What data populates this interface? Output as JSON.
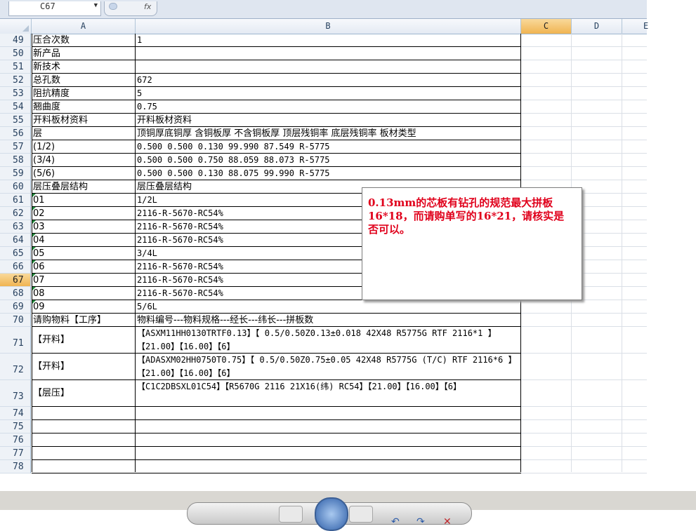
{
  "formula_bar": {
    "name_box": "C67",
    "fx_label": "fx"
  },
  "columns": [
    "A",
    "B",
    "C",
    "D",
    "E"
  ],
  "selected_column": "C",
  "selected_row": "67",
  "rows": [
    {
      "num": "49",
      "a": "压合次数",
      "b": "1"
    },
    {
      "num": "50",
      "a": "新产品",
      "b": ""
    },
    {
      "num": "51",
      "a": "新技术",
      "b": ""
    },
    {
      "num": "52",
      "a": "总孔数",
      "b": "672"
    },
    {
      "num": "53",
      "a": "阻抗精度",
      "b": "5"
    },
    {
      "num": "54",
      "a": "翘曲度",
      "b": "0.75"
    },
    {
      "num": "55",
      "a": "开料板材资料",
      "b": "开料板材资料"
    },
    {
      "num": "56",
      "a": "层",
      "b": "顶铜厚底铜厚 含铜板厚 不含铜板厚 顶层残铜率 底层残铜率 板材类型"
    },
    {
      "num": "57",
      "a": "(1/2)",
      "b": "0.500  0.500           0.130       99.990    87.549      R-5775"
    },
    {
      "num": "58",
      "a": "(3/4)",
      "b": "0.500  0.500           0.750       88.059    88.073      R-5775"
    },
    {
      "num": "59",
      "a": "(5/6)",
      "b": "0.500  0.500           0.130       88.075    99.990      R-5775"
    },
    {
      "num": "60",
      "a": "层压叠层结构",
      "b": "层压叠层结构"
    },
    {
      "num": "61",
      "a": "01",
      "b": "1/2L"
    },
    {
      "num": "62",
      "a": "02",
      "b": "2116-R-5670-RC54%"
    },
    {
      "num": "63",
      "a": "03",
      "b": "2116-R-5670-RC54%"
    },
    {
      "num": "64",
      "a": "04",
      "b": "2116-R-5670-RC54%"
    },
    {
      "num": "65",
      "a": "05",
      "b": "3/4L"
    },
    {
      "num": "66",
      "a": "06",
      "b": "2116-R-5670-RC54%"
    },
    {
      "num": "67",
      "a": "07",
      "b": "2116-R-5670-RC54%"
    },
    {
      "num": "68",
      "a": "08",
      "b": "2116-R-5670-RC54%"
    },
    {
      "num": "69",
      "a": "09",
      "b": "5/6L"
    },
    {
      "num": "70",
      "a": "请购物料【工序】",
      "b": "物料编号---物料规格---经长---纬长---拼板数"
    },
    {
      "num": "71",
      "a": "【开料】",
      "b": "【ASXM11HH0130TRTF0.13】【 0.5/0.50Z0.13±0.018 42X48  R5775G RTF 2116*1 】【21.00】【16.00】【6】"
    },
    {
      "num": "72",
      "a": "【开料】",
      "b": "【ADASXM02HH0750T0.75】【 0.5/0.50Z0.75±0.05 42X48  R5775G (T/C) RTF 2116*6 】【21.00】【16.00】【6】"
    },
    {
      "num": "73",
      "a": "【层压】",
      "b": "【C1C2DBSXL01C54】【R5670G 2116 21X16(纬) RC54】【21.00】【16.00】【6】"
    },
    {
      "num": "74",
      "a": "",
      "b": ""
    },
    {
      "num": "75",
      "a": "",
      "b": ""
    },
    {
      "num": "76",
      "a": "",
      "b": ""
    },
    {
      "num": "77",
      "a": "",
      "b": ""
    },
    {
      "num": "78",
      "a": "",
      "b": ""
    }
  ],
  "comment": {
    "text": "0.13mm的芯板有钻孔的规范最大拼板16*18，而请购单写的16*21，请核实是否可以。"
  }
}
